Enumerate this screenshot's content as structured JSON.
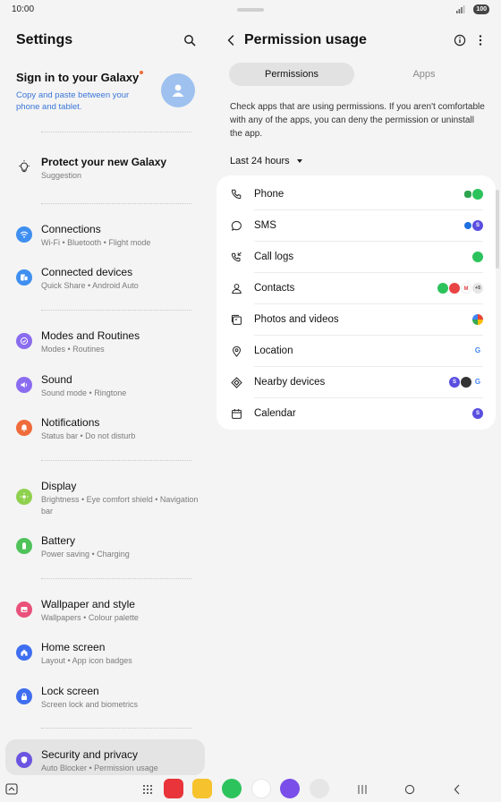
{
  "status": {
    "time": "10:00",
    "battery": "100"
  },
  "left": {
    "title": "Settings",
    "signin": {
      "title": "Sign in to your Galaxy",
      "subtitle": "Copy and paste between your phone and tablet."
    },
    "items": [
      {
        "title": "Protect your new Galaxy",
        "subtitle": "Suggestion",
        "icon": "lightbulb-icon"
      },
      {
        "title": "Connections",
        "subtitle": "Wi-Fi  •  Bluetooth  •  Flight mode",
        "icon": "wifi-icon",
        "color": "#3f8ff0"
      },
      {
        "title": "Connected devices",
        "subtitle": "Quick Share  •  Android Auto",
        "icon": "devices-icon",
        "color": "#3f8ff0"
      },
      {
        "title": "Modes and Routines",
        "subtitle": "Modes  •  Routines",
        "icon": "routines-icon",
        "color": "#8a6cf0"
      },
      {
        "title": "Sound",
        "subtitle": "Sound mode  •  Ringtone",
        "icon": "sound-icon",
        "color": "#8a6cf0"
      },
      {
        "title": "Notifications",
        "subtitle": "Status bar  •  Do not disturb",
        "icon": "bell-icon",
        "color": "#f06b3b"
      },
      {
        "title": "Display",
        "subtitle": "Brightness  •  Eye comfort shield  •  Navigation bar",
        "icon": "sun-icon",
        "color": "#8fd14f"
      },
      {
        "title": "Battery",
        "subtitle": "Power saving  •  Charging",
        "icon": "battery-icon",
        "color": "#4fc35a"
      },
      {
        "title": "Wallpaper and style",
        "subtitle": "Wallpapers  •  Colour palette",
        "icon": "wallpaper-icon",
        "color": "#e9517a"
      },
      {
        "title": "Home screen",
        "subtitle": "Layout  •  App icon badges",
        "icon": "home-icon",
        "color": "#3f6ff0"
      },
      {
        "title": "Lock screen",
        "subtitle": "Screen lock and biometrics",
        "icon": "lock-icon",
        "color": "#3f6ff0"
      },
      {
        "title": "Security and privacy",
        "subtitle": "Auto Blocker  •  Permission usage",
        "icon": "shield-icon",
        "color": "#6b55e0"
      }
    ]
  },
  "right": {
    "title": "Permission usage",
    "tabs": [
      "Permissions",
      "Apps"
    ],
    "description": "Check apps that are using permissions. If you aren't comfortable with any of the apps, you can deny the permission or uninstall the app.",
    "range": "Last 24 hours",
    "permissions": [
      {
        "label": "Phone",
        "icon": "phone-icon"
      },
      {
        "label": "SMS",
        "icon": "message-icon"
      },
      {
        "label": "Call logs",
        "icon": "call-log-icon"
      },
      {
        "label": "Contacts",
        "icon": "contacts-icon",
        "more": "+5"
      },
      {
        "label": "Photos and videos",
        "icon": "photos-icon"
      },
      {
        "label": "Location",
        "icon": "location-icon"
      },
      {
        "label": "Nearby devices",
        "icon": "nearby-icon"
      },
      {
        "label": "Calendar",
        "icon": "calendar-icon"
      }
    ]
  }
}
